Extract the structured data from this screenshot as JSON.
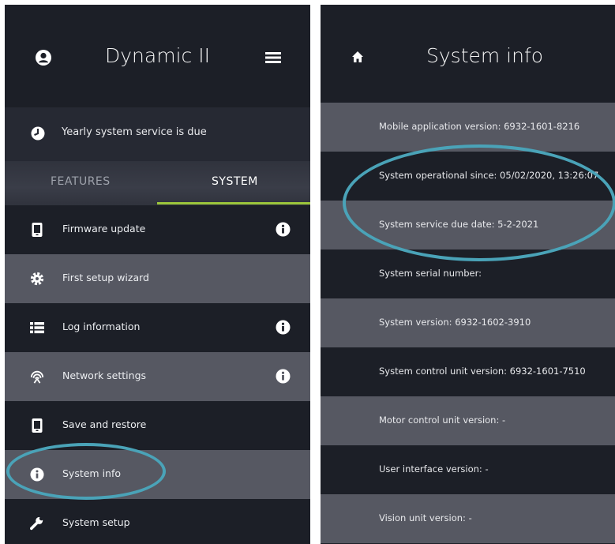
{
  "left_panel": {
    "header": {
      "title": "Dynamic II",
      "user_icon": "user-icon",
      "menu_icon": "hamburger-menu-icon"
    },
    "notice": {
      "text": "Yearly system service is due",
      "icon": "clock-icon"
    },
    "tabs": [
      {
        "label": "FEATURES",
        "active": false
      },
      {
        "label": "SYSTEM",
        "active": true
      }
    ],
    "menu": [
      {
        "label": "Firmware update",
        "icon": "device-icon",
        "has_info": true
      },
      {
        "label": "First setup wizard",
        "icon": "gear-icon",
        "has_info": false
      },
      {
        "label": "Log information",
        "icon": "list-icon",
        "has_info": true
      },
      {
        "label": "Network settings",
        "icon": "wifi-icon",
        "has_info": true
      },
      {
        "label": "Save and restore",
        "icon": "device-icon",
        "has_info": false
      },
      {
        "label": "System info",
        "icon": "info-icon",
        "has_info": false
      },
      {
        "label": "System setup",
        "icon": "wrench-icon",
        "has_info": false
      }
    ]
  },
  "right_panel": {
    "header": {
      "title": "System info",
      "home_icon": "home-icon"
    },
    "rows": [
      "Mobile application version: 6932-1601-8216",
      "System operational since: 05/02/2020, 13:26:07",
      "System service due date: 5-2-2021",
      "System serial number:",
      "System version: 6932-1602-3910",
      "System control unit version: 6932-1601-7510",
      "Motor control unit version: -",
      "User interface version: -",
      "Vision unit version: -"
    ]
  },
  "colors": {
    "background_dark": "#1c1f27",
    "background_row_light": "#565862",
    "tab_indicator": "#9cc63b",
    "highlight_circle": "#4aa3b8",
    "text": "#f1f2f4"
  }
}
